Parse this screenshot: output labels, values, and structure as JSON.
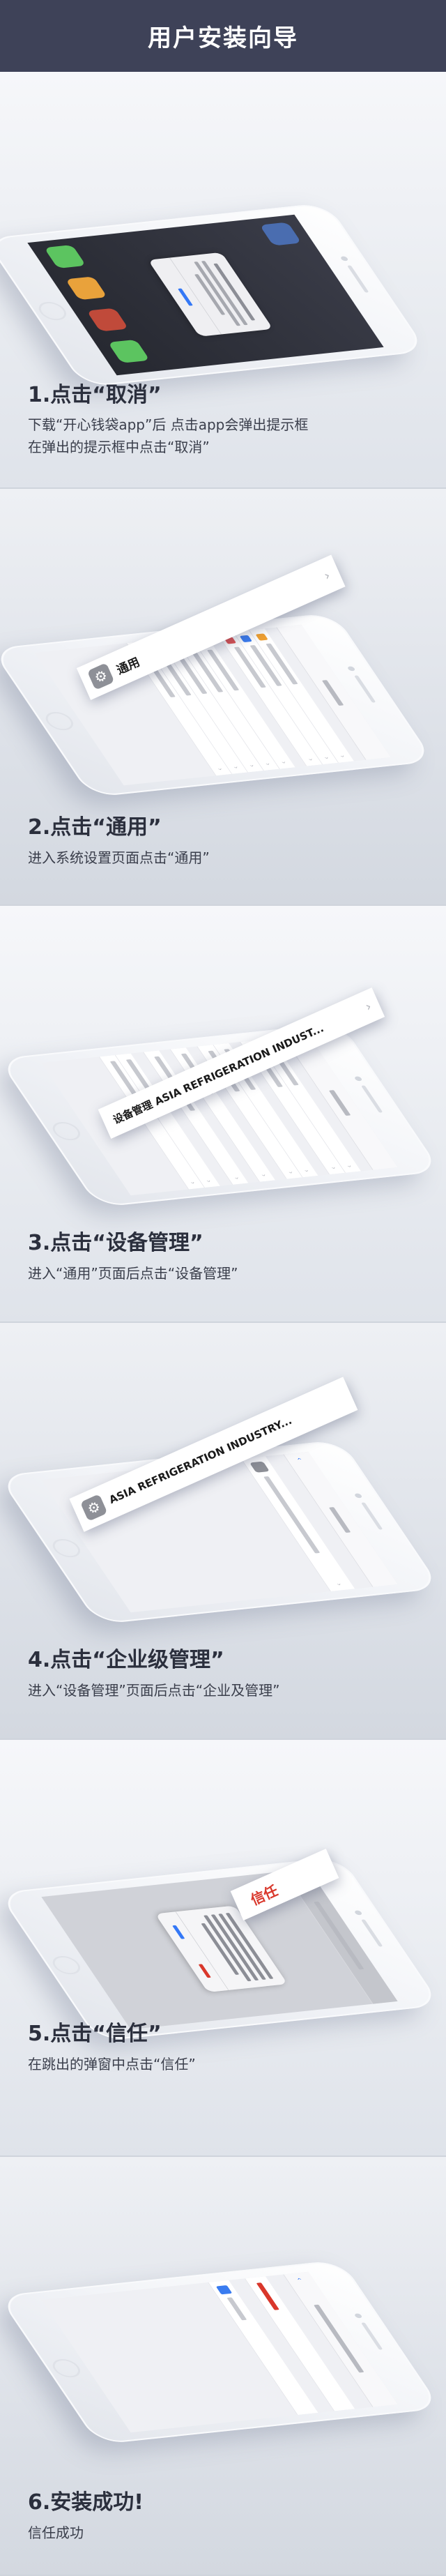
{
  "header": {
    "title": "用户安装向导"
  },
  "steps": [
    {
      "title": "1.点击“取消”",
      "desc_lines": [
        "下载“开心钱袋app”后  点击app会弹出提示框",
        "在弹出的提示框中点击“取消”"
      ],
      "callout": ""
    },
    {
      "title": "2.点击“通用”",
      "desc_lines": [
        "进入系统设置页面点击“通用”"
      ],
      "callout": "通用"
    },
    {
      "title": "3.点击“设备管理”",
      "desc_lines": [
        "进入“通用”页面后点击“设备管理”"
      ],
      "callout": "设备管理  ASIA REFRIGERATION INDUST..."
    },
    {
      "title": "4.点击“企业级管理”",
      "desc_lines": [
        "进入“设备管理”页面后点击“企业及管理”"
      ],
      "callout": "ASIA REFRIGERATION INDUSTRY..."
    },
    {
      "title": "5.点击“信任”",
      "desc_lines": [
        "在跳出的弹窗中点击“信任”"
      ],
      "callout": "信任"
    },
    {
      "title": "6.安装成功!",
      "desc_lines": [
        "信任成功"
      ],
      "callout": ""
    }
  ],
  "colors": {
    "header_bg": "#3e4258",
    "accent": "#3478f6",
    "trust_red": "#d9372b"
  }
}
